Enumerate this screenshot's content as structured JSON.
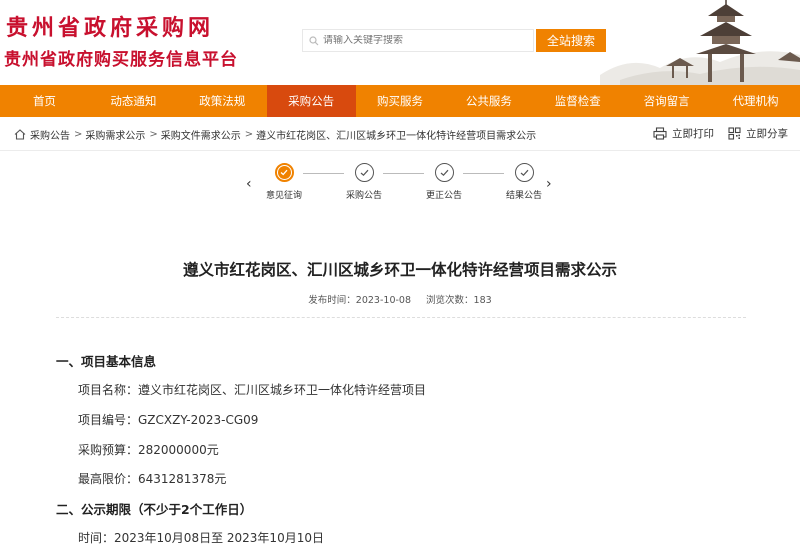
{
  "header": {
    "title_line1": "贵州省政府采购网",
    "title_line2": "贵州省政府购买服务信息平台",
    "search_placeholder": "请输入关键字搜索",
    "search_button": "全站搜索"
  },
  "nav": {
    "items": [
      "首页",
      "动态通知",
      "政策法规",
      "采购公告",
      "购买服务",
      "公共服务",
      "监督检查",
      "咨询留言",
      "代理机构"
    ],
    "active_index": 3
  },
  "breadcrumb": {
    "items": [
      "采购公告",
      "采购需求公示",
      "采购文件需求公示",
      "遵义市红花岗区、汇川区城乡环卫一体化特许经营项目需求公示"
    ],
    "separator": ">"
  },
  "tools": {
    "print": "立即打印",
    "share": "立即分享"
  },
  "progress": {
    "steps": [
      "意见征询",
      "采购公告",
      "更正公告",
      "结果公告"
    ],
    "current_index": 0,
    "prev_arrow": "‹",
    "next_arrow": "›"
  },
  "article": {
    "title": "遵义市红花岗区、汇川区城乡环卫一体化特许经营项目需求公示",
    "publish_time": "发布时间：2023-10-08",
    "views": "浏览次数：183",
    "section1": "一、项目基本信息",
    "project_name": "项目名称：遵义市红花岗区、汇川区城乡环卫一体化特许经营项目",
    "project_number": "项目编号：GZCXZY-2023-CG09",
    "budget": "采购预算：282000000元",
    "max_price": "最高限价：6431281378元",
    "section2": "二、公示期限（不少于2个工作日）",
    "period": "时间：2023年10月08日至 2023年10月10日"
  },
  "colors": {
    "brand_red": "#c8102e",
    "nav_orange": "#f08200",
    "nav_active": "#d84a0e",
    "step_active": "#f08200"
  }
}
